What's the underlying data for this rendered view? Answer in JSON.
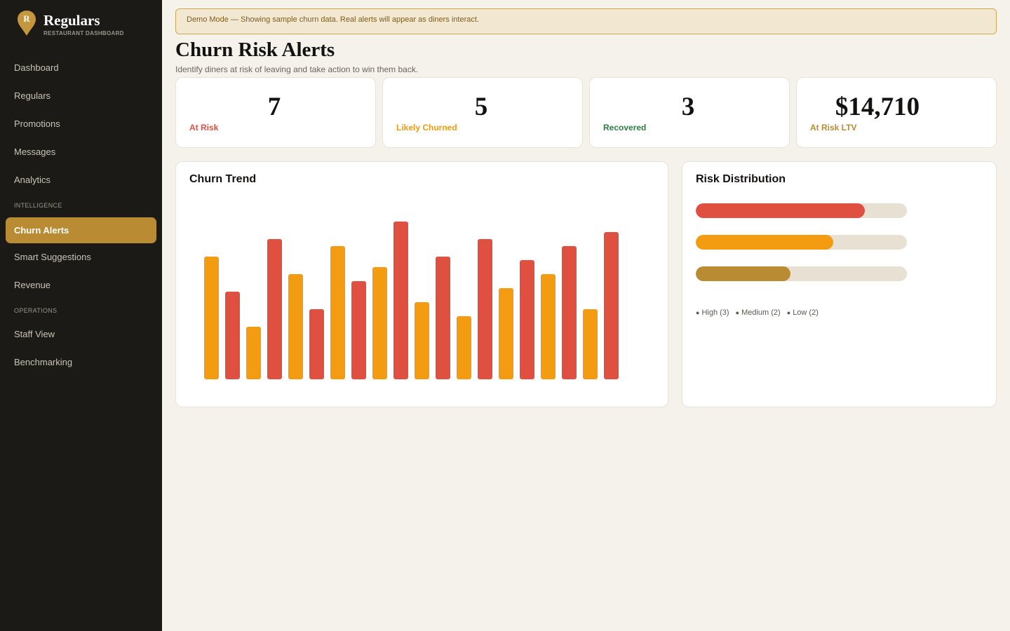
{
  "brand": {
    "title": "Regulars",
    "subtitle": "RESTAURANT DASHBOARD",
    "logo_letter": "R"
  },
  "sidebar": {
    "items": [
      {
        "label": "Dashboard"
      },
      {
        "label": "Regulars"
      },
      {
        "label": "Promotions"
      },
      {
        "label": "Messages"
      },
      {
        "label": "Analytics"
      },
      {
        "label": "Churn Alerts",
        "active": true
      },
      {
        "label": "Smart Suggestions"
      },
      {
        "label": "Revenue"
      },
      {
        "label": "Staff View"
      },
      {
        "label": "Benchmarking"
      }
    ],
    "sections": {
      "intelligence": "INTELLIGENCE",
      "operations": "OPERATIONS"
    }
  },
  "banner": {
    "text": "Demo Mode — Showing sample churn data. Real alerts will appear as diners interact."
  },
  "header": {
    "title": "Churn Risk Alerts",
    "subtitle": "Identify diners at risk of leaving and take action to win them back."
  },
  "stats": [
    {
      "value": "7",
      "label": "At Risk",
      "color": "#e05040"
    },
    {
      "value": "5",
      "label": "Likely Churned",
      "color": "#f39c12"
    },
    {
      "value": "3",
      "label": "Recovered",
      "color": "#2e7d45"
    },
    {
      "value": "$14,710",
      "label": "At Risk LTV",
      "color": "#b98c34"
    }
  ],
  "colors": {
    "high": "#e05040",
    "medium": "#f39c12",
    "low": "#b98c34",
    "accent": "#b98c34"
  },
  "trend": {
    "title": "Churn Trend"
  },
  "distribution": {
    "title": "Risk Distribution",
    "bars": [
      {
        "name": "High",
        "fraction": 0.8,
        "color": "#e05040"
      },
      {
        "name": "Medium",
        "fraction": 0.65,
        "color": "#f39c12"
      },
      {
        "name": "Low",
        "fraction": 0.45,
        "color": "#b98c34"
      }
    ],
    "legend": [
      "High (3)",
      "Medium (2)",
      "Low (2)"
    ]
  },
  "chart_data": {
    "type": "bar",
    "title": "Churn Trend",
    "values": [
      175,
      125,
      75,
      200,
      150,
      100,
      190,
      140,
      160,
      225,
      110,
      175,
      90,
      200,
      130,
      170,
      150,
      190,
      100,
      210
    ],
    "colors": [
      "#f39c12",
      "#e05040",
      "#f39c12",
      "#e05040",
      "#f39c12",
      "#e05040",
      "#f39c12",
      "#e05040",
      "#f39c12",
      "#e05040",
      "#f39c12",
      "#e05040",
      "#f39c12",
      "#e05040",
      "#f39c12",
      "#e05040",
      "#f39c12",
      "#e05040",
      "#f39c12",
      "#e05040"
    ],
    "xlabel": "",
    "ylabel": "",
    "grid": false
  }
}
